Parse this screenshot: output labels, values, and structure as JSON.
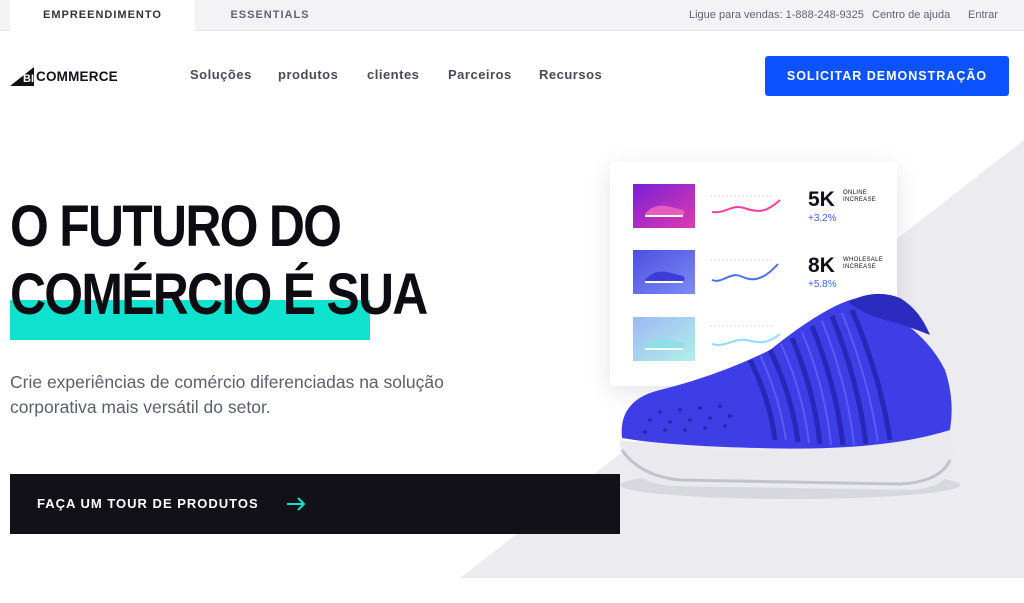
{
  "topbar": {
    "tabs": [
      "EMPREENDIMENTO",
      "ESSENTIALS"
    ],
    "sales": "Ligue para vendas: 1-888-248-9325",
    "help": "Centro de ajuda",
    "login": "Entrar"
  },
  "nav": {
    "logo_big": "BIG",
    "logo_text": "COMMERCE",
    "links": [
      "Soluções",
      "produtos",
      "clientes",
      "Parceiros",
      "Recursos"
    ],
    "cta": "SOLICITAR DEMONSTRAÇÃO"
  },
  "hero": {
    "headline_1": "O FUTURO DO",
    "headline_2": "COMÉRCIO É SUA",
    "subtitle": "Crie experiências de comércio diferenciadas na solução corporativa mais versátil do setor.",
    "tour_label": "FAÇA UM TOUR DE PRODUTOS"
  },
  "stats": [
    {
      "value": "5K",
      "tag1": "ONLINE",
      "tag2": "INCREASE",
      "delta": "+3.2%",
      "color": "#ff3fa4",
      "thumb": "#b21fd6"
    },
    {
      "value": "8K",
      "tag1": "WHOLESALE",
      "tag2": "INCREASE",
      "delta": "+5.8%",
      "color": "#4d6bff",
      "thumb": "#5a5ee8"
    },
    {
      "value": "",
      "tag1": "",
      "tag2": "",
      "delta": "",
      "color": "#8fdcff",
      "thumb": "#8ec8f5"
    }
  ],
  "colors": {
    "accent_blue": "#0d52ff",
    "highlight_teal": "#0fe3d0",
    "dark": "#121118",
    "shoe_blue": "#3e3ee6"
  }
}
